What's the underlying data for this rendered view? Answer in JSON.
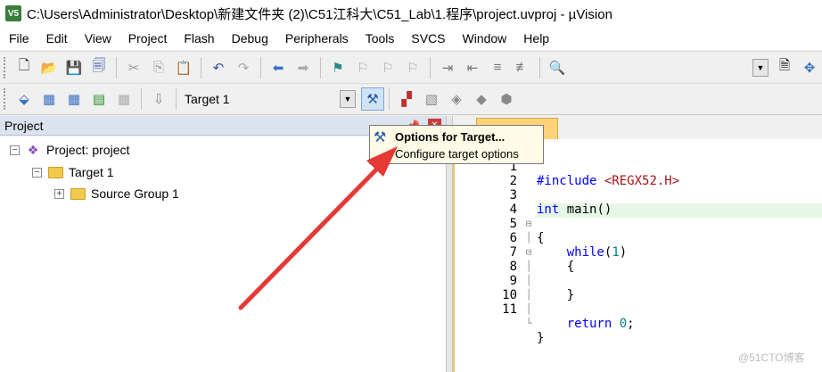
{
  "window": {
    "title": "C:\\Users\\Administrator\\Desktop\\新建文件夹 (2)\\C51江科大\\C51_Lab\\1.程序\\project.uvproj - µVision",
    "app_icon_text": "V5"
  },
  "menu": [
    "File",
    "Edit",
    "View",
    "Project",
    "Flash",
    "Debug",
    "Peripherals",
    "Tools",
    "SVCS",
    "Window",
    "Help"
  ],
  "toolbar2": {
    "target_select_value": "Target 1"
  },
  "project_panel": {
    "title": "Project",
    "tree": {
      "project_label": "Project: project",
      "target_label": "Target 1",
      "group_label": "Source Group 1"
    }
  },
  "tooltip": {
    "title": "Options for Target...",
    "description": "Configure target options"
  },
  "editor": {
    "lines": [
      {
        "n": "1",
        "text": "#include <REGX52.H>"
      },
      {
        "n": "2",
        "text": ""
      },
      {
        "n": "3",
        "text": "int main()"
      },
      {
        "n": "4",
        "text": "{"
      },
      {
        "n": "5",
        "text": "    while(1)"
      },
      {
        "n": "6",
        "text": "    {"
      },
      {
        "n": "7",
        "text": ""
      },
      {
        "n": "8",
        "text": "    }"
      },
      {
        "n": "9",
        "text": ""
      },
      {
        "n": "10",
        "text": "    return 0;"
      },
      {
        "n": "11",
        "text": "}"
      }
    ]
  },
  "watermark": "@51CTO博客",
  "colors": {
    "annotation_arrow": "#e53935",
    "tooltip_bg": "#fffbe6",
    "keyword": "#0000ff"
  }
}
